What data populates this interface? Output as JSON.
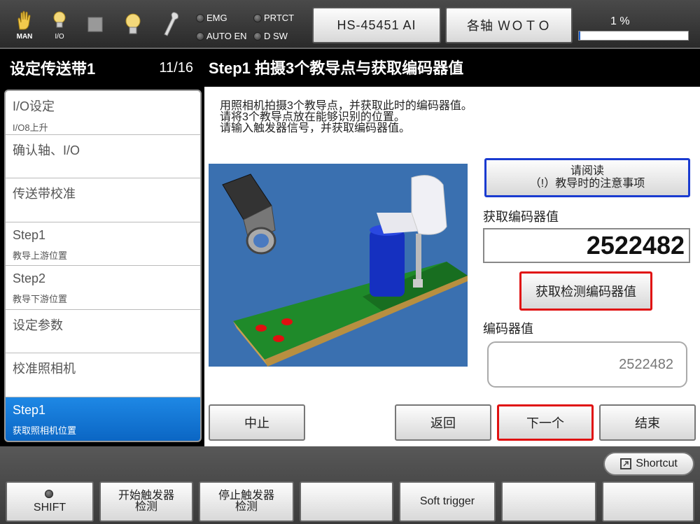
{
  "topbar": {
    "icons": [
      {
        "name": "hand-icon",
        "caption": "MAN"
      },
      {
        "name": "bulb-icon",
        "caption": "I/O"
      },
      {
        "name": "stop-square-icon",
        "caption": ""
      },
      {
        "name": "lightbulb-icon",
        "caption": ""
      },
      {
        "name": "wrench-icon",
        "caption": ""
      }
    ],
    "status": {
      "emg": "EMG",
      "prtct": "PRTCT",
      "auto_en": "AUTO EN",
      "d_sw": "D SW"
    },
    "model_button": "HS-45451 AI",
    "axis_button": "各轴 ＷＯＴＯ",
    "speed_label": "1 %",
    "speed_percent": 1
  },
  "left": {
    "title": "设定传送带1",
    "counter": "11/16",
    "steps": [
      {
        "label": "I/O设定",
        "sub": "I/O8上升",
        "active": false
      },
      {
        "label": "确认轴、I/O",
        "sub": "",
        "active": false
      },
      {
        "label": "传送带校准",
        "sub": "",
        "active": false
      },
      {
        "label": "Step1",
        "sub": "教导上游位置",
        "active": false
      },
      {
        "label": "Step2",
        "sub": "教导下游位置",
        "active": false
      },
      {
        "label": "设定参数",
        "sub": "",
        "active": false
      },
      {
        "label": "校准照相机",
        "sub": "",
        "active": false
      },
      {
        "label": "Step1",
        "sub": "获取照相机位置",
        "active": true
      }
    ]
  },
  "main": {
    "title": "Step1 拍摄3个教导点与获取编码器值",
    "instructions": [
      "用照相机拍摄3个教导点，并获取此时的编码器值。",
      "请将3个教导点放在能够识别的位置。",
      "请输入触发器信号，并获取编码器值。"
    ],
    "read_button_line1": "请阅读",
    "read_button_line2": "（!）教导时的注意事项",
    "get_encoder_label": "获取编码器值",
    "encoder_value_input": "2522482",
    "get_detect_button": "获取检测编码器值",
    "encoder_label": "编码器值",
    "encoder_display": "2522482",
    "buttons": {
      "abort": "中止",
      "back": "返回",
      "next": "下一个",
      "end": "结束"
    },
    "colors": {
      "read_border": "#1a3bd0",
      "highlight_border": "#e01010"
    }
  },
  "bottom": {
    "shortcut": "Shortcut",
    "fkeys": [
      {
        "line1": "",
        "line2": "SHIFT"
      },
      {
        "line1": "开始触发器",
        "line2": "检测"
      },
      {
        "line1": "停止触发器",
        "line2": "检测"
      },
      {
        "line1": "",
        "line2": ""
      },
      {
        "line1": "Soft trigger",
        "line2": ""
      },
      {
        "line1": "",
        "line2": ""
      },
      {
        "line1": "",
        "line2": ""
      }
    ]
  }
}
